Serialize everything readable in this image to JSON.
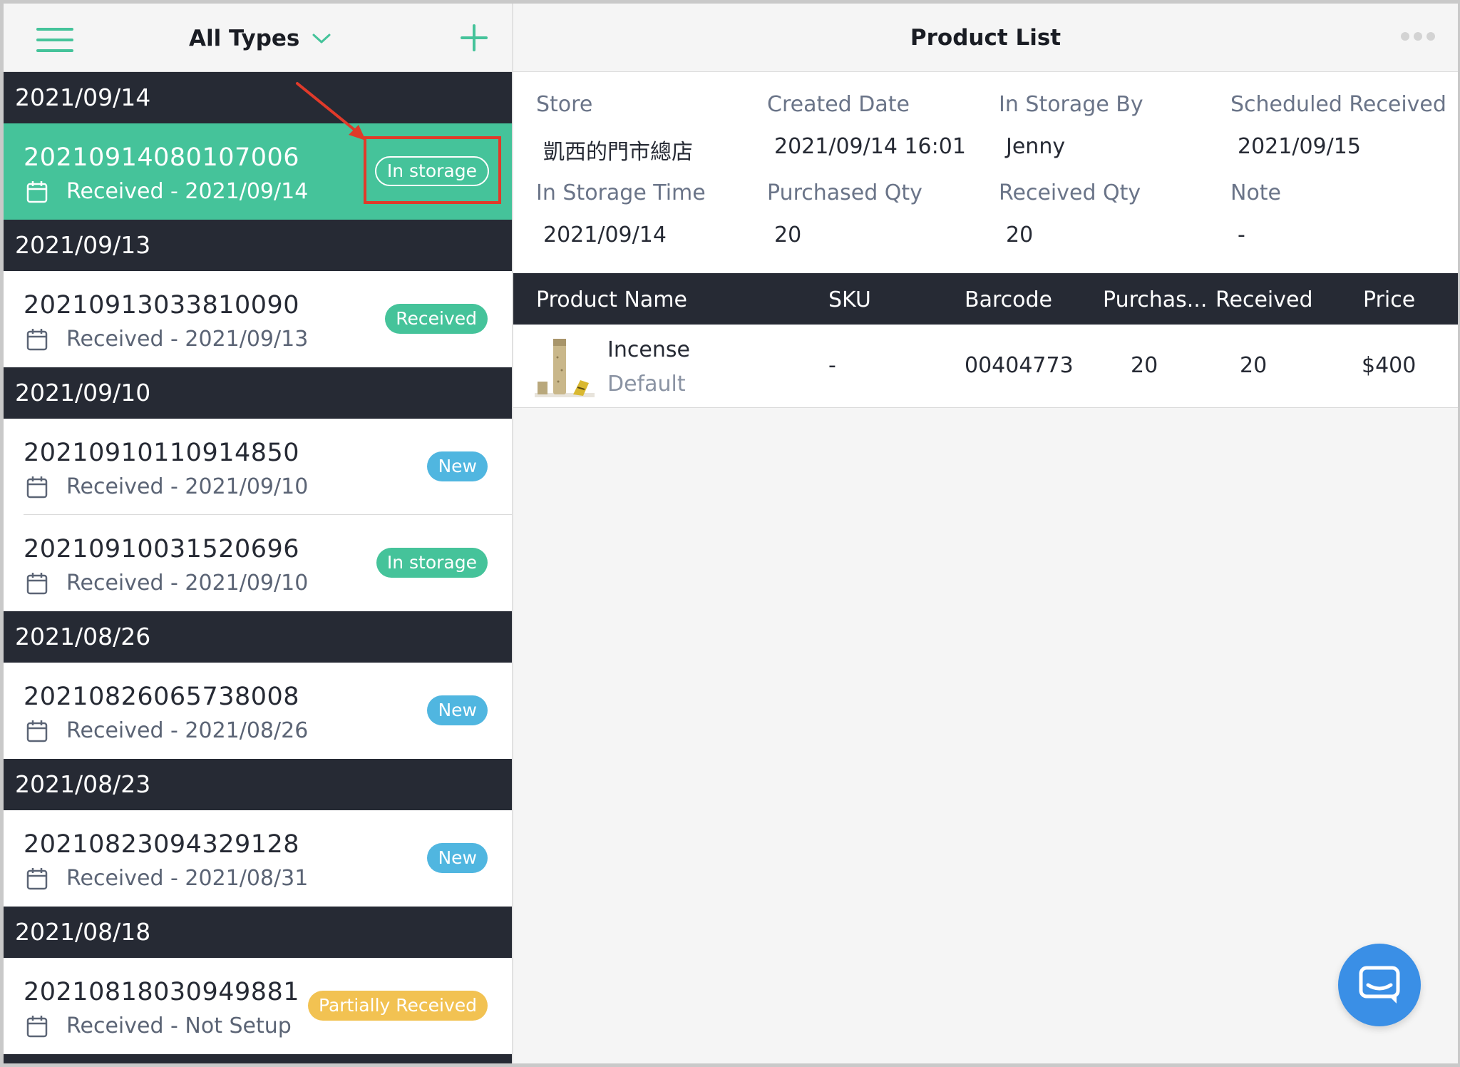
{
  "colors": {
    "accent": "#45c39a",
    "dark_header": "#262a34",
    "new_badge": "#50b6e0",
    "partial_badge": "#f2c252",
    "highlight": "#e03a2a",
    "chat": "#3a8fe6"
  },
  "left_header": {
    "menu_icon": "hamburger-icon",
    "filter_label": "All Types",
    "filter_icon": "chevron-down-icon",
    "add_icon": "plus-icon"
  },
  "groups": [
    {
      "date": "2021/09/14",
      "orders": [
        {
          "number": "20210914080107006",
          "received": "Received - 2021/09/14",
          "status": "In storage"
        }
      ]
    },
    {
      "date": "2021/09/13",
      "orders": [
        {
          "number": "20210913033810090",
          "received": "Received - 2021/09/13",
          "status": "Received"
        }
      ]
    },
    {
      "date": "2021/09/10",
      "orders": [
        {
          "number": "20210910110914850",
          "received": "Received - 2021/09/10",
          "status": "New"
        },
        {
          "number": "20210910031520696",
          "received": "Received - 2021/09/10",
          "status": "In storage"
        }
      ]
    },
    {
      "date": "2021/08/26",
      "orders": [
        {
          "number": "20210826065738008",
          "received": "Received - 2021/08/26",
          "status": "New"
        }
      ]
    },
    {
      "date": "2021/08/23",
      "orders": [
        {
          "number": "20210823094329128",
          "received": "Received - 2021/08/31",
          "status": "New"
        }
      ]
    },
    {
      "date": "2021/08/18",
      "orders": [
        {
          "number": "20210818030949881",
          "received": "Received - Not Setup",
          "status": "Partially Received"
        }
      ]
    }
  ],
  "right_header": {
    "title": "Product List",
    "more_icon": "more-dots-icon"
  },
  "info": {
    "store_label": "Store",
    "store_value": "凱西的門市總店",
    "created_label": "Created Date",
    "created_value": "2021/09/14 16:01",
    "storage_by_label": "In Storage By",
    "storage_by_value": "Jenny",
    "scheduled_label": "Scheduled Received",
    "scheduled_value": "2021/09/15",
    "storage_time_label": "In Storage Time",
    "storage_time_value": "2021/09/14",
    "purchased_label": "Purchased Qty",
    "purchased_value": "20",
    "received_label": "Received Qty",
    "received_value": "20",
    "note_label": "Note",
    "note_value": "-"
  },
  "table": {
    "headers": [
      "Product Name",
      "SKU",
      "Barcode",
      "Purchas...",
      "Received",
      "Price"
    ],
    "rows": [
      {
        "name": "Incense",
        "variant": "Default",
        "sku": "-",
        "barcode": "00404773",
        "purchased": "20",
        "received": "20",
        "price": "$400"
      }
    ]
  },
  "chat_icon": "chat-icon"
}
